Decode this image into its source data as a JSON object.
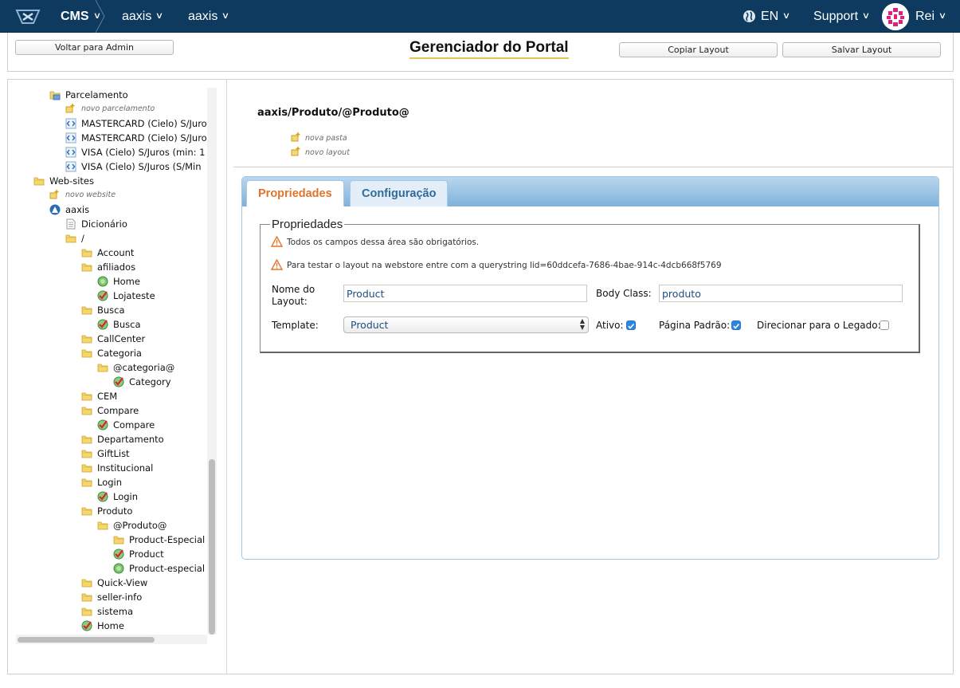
{
  "topbar": {
    "cms": "CMS",
    "store1": "aaxis",
    "store2": "aaxis",
    "language": "EN",
    "support": "Support",
    "user": "Rei",
    "bg_color": "#0d3a5e"
  },
  "header": {
    "back_button": "Voltar para Admin",
    "title": "Gerenciador do Portal",
    "copy_button": "Copiar Layout",
    "save_button": "Salvar Layout"
  },
  "tree": {
    "items": [
      {
        "label": "Parcelamento",
        "icon": "payment-icon"
      },
      {
        "label": "novo parcelamento",
        "icon": "new-icon",
        "small": true
      },
      {
        "label": "MASTERCARD (Cielo) S/Juro",
        "icon": "code-icon"
      },
      {
        "label": "MASTERCARD (Cielo) S/Juro",
        "icon": "code-icon"
      },
      {
        "label": "VISA (Cielo) S/Juros (min: 1",
        "icon": "code-icon"
      },
      {
        "label": "VISA (Cielo) S/Juros (S/Min",
        "icon": "code-icon"
      },
      {
        "label": "Web-sites",
        "icon": "folder-icon"
      },
      {
        "label": "novo website",
        "icon": "new-icon",
        "small": true
      },
      {
        "label": "aaxis",
        "icon": "website-icon"
      },
      {
        "label": "Dicionário",
        "icon": "document-icon"
      },
      {
        "label": "/",
        "icon": "folder-icon"
      },
      {
        "label": "Account",
        "icon": "folder-icon"
      },
      {
        "label": "afiliados",
        "icon": "folder-icon"
      },
      {
        "label": "Home",
        "icon": "globe-icon"
      },
      {
        "label": "Lojateste",
        "icon": "check-icon"
      },
      {
        "label": "Busca",
        "icon": "folder-icon"
      },
      {
        "label": "Busca",
        "icon": "check-icon"
      },
      {
        "label": "CallCenter",
        "icon": "folder-icon"
      },
      {
        "label": "Categoria",
        "icon": "folder-icon"
      },
      {
        "label": "@categoria@",
        "icon": "folder-icon"
      },
      {
        "label": "Category",
        "icon": "check-icon"
      },
      {
        "label": "CEM",
        "icon": "folder-icon"
      },
      {
        "label": "Compare",
        "icon": "folder-icon"
      },
      {
        "label": "Compare",
        "icon": "check-icon"
      },
      {
        "label": "Departamento",
        "icon": "folder-icon"
      },
      {
        "label": "GiftList",
        "icon": "folder-icon"
      },
      {
        "label": "Institucional",
        "icon": "folder-icon"
      },
      {
        "label": "Login",
        "icon": "folder-icon"
      },
      {
        "label": "Login",
        "icon": "check-icon"
      },
      {
        "label": "Produto",
        "icon": "folder-icon"
      },
      {
        "label": "@Produto@",
        "icon": "folder-icon"
      },
      {
        "label": "Product-Especial",
        "icon": "folder-icon"
      },
      {
        "label": "Product",
        "icon": "check-icon"
      },
      {
        "label": "Product-especial",
        "icon": "globe-icon"
      },
      {
        "label": "Quick-View",
        "icon": "folder-icon"
      },
      {
        "label": "seller-info",
        "icon": "folder-icon"
      },
      {
        "label": "sistema",
        "icon": "folder-icon"
      },
      {
        "label": "Home",
        "icon": "check-icon"
      }
    ]
  },
  "main": {
    "path": "aaxis/Produto/@Produto@",
    "new_folder": "nova pasta",
    "new_layout": "novo layout",
    "tabs": [
      {
        "label": "Propriedades",
        "active": true
      },
      {
        "label": "Configuração",
        "active": false
      }
    ],
    "props": {
      "legend": "Propriedades",
      "warning1": "Todos os campos dessa área são obrigatórios.",
      "warning2": "Para testar o layout na webstore entre com a querystring lid=60ddcefa-7686-4bae-914c-4dcb668f5769",
      "name_label": "Nome do Layout:",
      "name_value": "Product",
      "body_class_label": "Body Class:",
      "body_class_value": "produto",
      "template_label": "Template:",
      "template_value": "Product",
      "active_label": "Ativo:",
      "active_checked": true,
      "default_page_label": "Página Padrão:",
      "default_page_checked": true,
      "legacy_label": "Direcionar para o Legado:",
      "legacy_checked": false
    }
  },
  "colors": {
    "active_tab": "#e0742b",
    "inactive_tab": "#2f6a9a",
    "checkbox": "#2f86e0",
    "warning": "#e8742a"
  }
}
